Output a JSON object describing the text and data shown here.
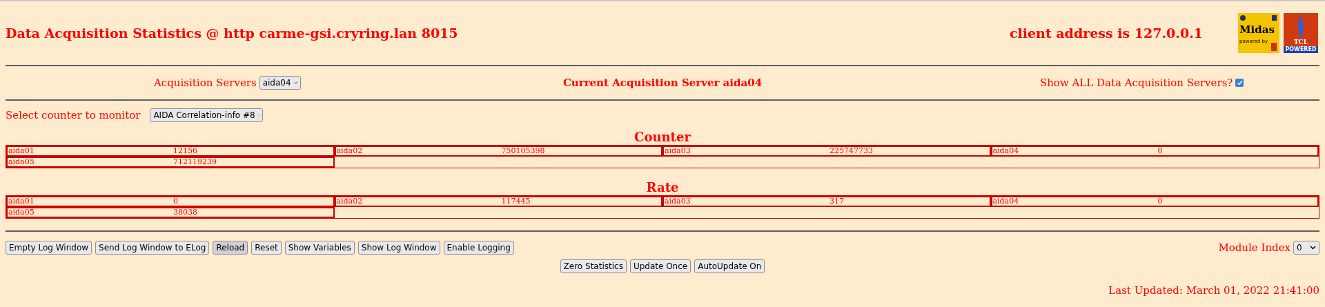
{
  "header": {
    "title": "Data Acquisition Statistics @ http carme-gsi.cryring.lan 8015",
    "client": "client address is 127.0.0.1",
    "logos": {
      "midas": "Midas",
      "midas_sub": "powered by",
      "tcl": "TCL",
      "tcl_sub": "POWERED"
    }
  },
  "servers": {
    "label": "Acquisition Servers",
    "value": "aida04",
    "current": "Current Acquisition Server aida04",
    "show_all_label": "Show ALL Data Acquisition Servers?",
    "show_all_checked": true
  },
  "counter_select": {
    "label": "Select counter to monitor",
    "value": "AIDA Correlation-info #8"
  },
  "tables": [
    {
      "title": "Counter",
      "cells": [
        {
          "name": "aida01",
          "value": "12156"
        },
        {
          "name": "aida02",
          "value": "750105398"
        },
        {
          "name": "aida03",
          "value": "225747733"
        },
        {
          "name": "aida04",
          "value": "0"
        },
        {
          "name": "aida05",
          "value": "712119239"
        }
      ]
    },
    {
      "title": "Rate",
      "cells": [
        {
          "name": "aida01",
          "value": "0"
        },
        {
          "name": "aida02",
          "value": "117445"
        },
        {
          "name": "aida03",
          "value": "317"
        },
        {
          "name": "aida04",
          "value": "0"
        },
        {
          "name": "aida05",
          "value": "38038"
        }
      ]
    }
  ],
  "buttons": [
    {
      "label": "Empty Log Window",
      "pressed": false
    },
    {
      "label": "Send Log Window to ELog",
      "pressed": false
    },
    {
      "label": "Reload",
      "pressed": true
    },
    {
      "label": "Reset",
      "pressed": false
    },
    {
      "label": "Show Variables",
      "pressed": false
    },
    {
      "label": "Show Log Window",
      "pressed": false
    },
    {
      "label": "Enable Logging",
      "pressed": false
    }
  ],
  "module_index": {
    "label": "Module Index",
    "value": "0"
  },
  "control_buttons": [
    {
      "label": "Zero Statistics",
      "pressed": false
    },
    {
      "label": "Update Once",
      "pressed": false
    },
    {
      "label": "AutoUpdate On",
      "pressed": false
    }
  ],
  "last_updated": "Last Updated: March 01, 2022 21:41:00"
}
